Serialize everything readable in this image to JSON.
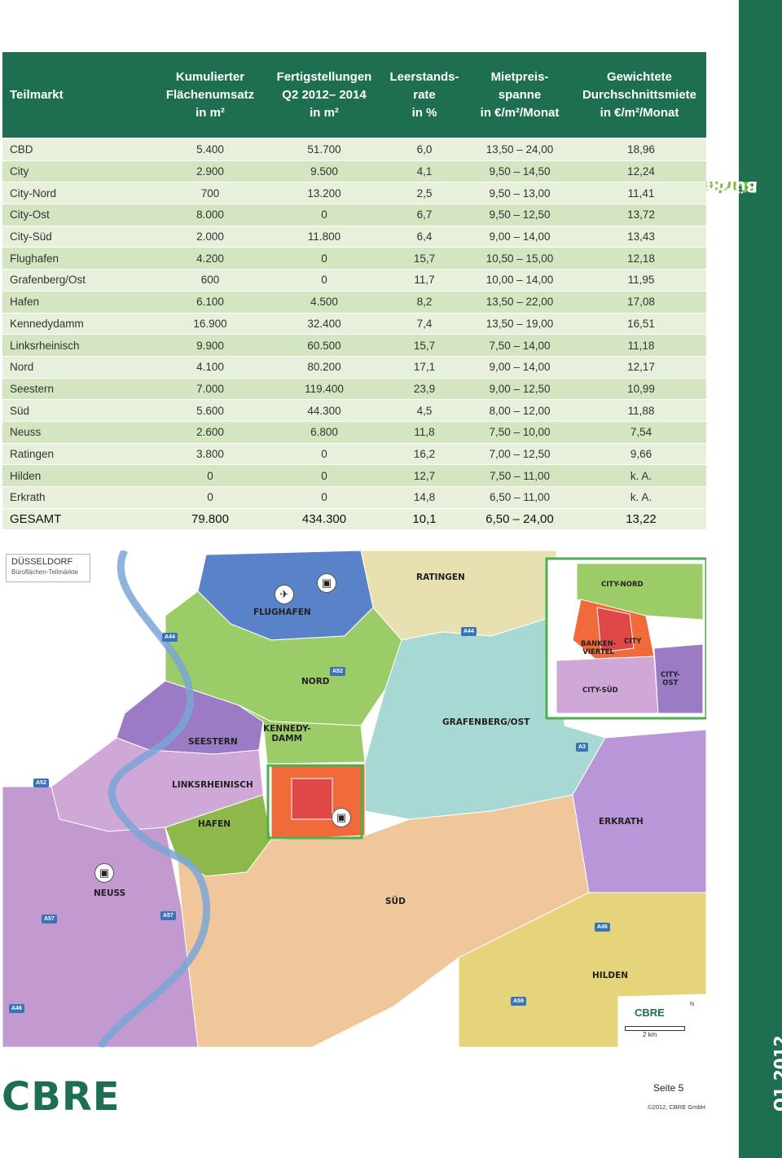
{
  "header": {
    "columns": [
      "Teilmarkt",
      "Kumulierter\nFlächenumsatz\nin m²",
      "Fertigstellungen\nQ2 2012– 2014\nin m²",
      "Leerstands-\nrate\nin %",
      "Mietpreis-\nspanne\nin €/m²/Monat",
      "Gewichtete\nDurchschnittsmiete\nin €/m²/Monat"
    ]
  },
  "rows": [
    {
      "name": "CBD",
      "umsatz": "5.400",
      "fertig": "51.700",
      "leer": "6,0",
      "spanne": "13,50 – 24,00",
      "miete": "18,96"
    },
    {
      "name": "City",
      "umsatz": "2.900",
      "fertig": "9.500",
      "leer": "4,1",
      "spanne": "9,50 – 14,50",
      "miete": "12,24"
    },
    {
      "name": "City-Nord",
      "umsatz": "700",
      "fertig": "13.200",
      "leer": "2,5",
      "spanne": "9,50 – 13,00",
      "miete": "11,41"
    },
    {
      "name": "City-Ost",
      "umsatz": "8.000",
      "fertig": "0",
      "leer": "6,7",
      "spanne": "9,50 – 12,50",
      "miete": "13,72"
    },
    {
      "name": "City-Süd",
      "umsatz": "2.000",
      "fertig": "11.800",
      "leer": "6,4",
      "spanne": "9,00 – 14,00",
      "miete": "13,43"
    },
    {
      "name": "Flughafen",
      "umsatz": "4.200",
      "fertig": "0",
      "leer": "15,7",
      "spanne": "10,50 – 15,00",
      "miete": "12,18"
    },
    {
      "name": "Grafenberg/Ost",
      "umsatz": "600",
      "fertig": "0",
      "leer": "11,7",
      "spanne": "10,00 – 14,00",
      "miete": "11,95"
    },
    {
      "name": "Hafen",
      "umsatz": "6.100",
      "fertig": "4.500",
      "leer": "8,2",
      "spanne": "13,50 – 22,00",
      "miete": "17,08"
    },
    {
      "name": "Kennedydamm",
      "umsatz": "16.900",
      "fertig": "32.400",
      "leer": "7,4",
      "spanne": "13,50 – 19,00",
      "miete": "16,51"
    },
    {
      "name": "Linksrheinisch",
      "umsatz": "9.900",
      "fertig": "60.500",
      "leer": "15,7",
      "spanne": "7,50 – 14,00",
      "miete": "11,18"
    },
    {
      "name": "Nord",
      "umsatz": "4.100",
      "fertig": "80.200",
      "leer": "17,1",
      "spanne": "9,00 – 14,00",
      "miete": "12,17"
    },
    {
      "name": "Seestern",
      "umsatz": "7.000",
      "fertig": "119.400",
      "leer": "23,9",
      "spanne": "9,00 – 12,50",
      "miete": "10,99"
    },
    {
      "name": "Süd",
      "umsatz": "5.600",
      "fertig": "44.300",
      "leer": "4,5",
      "spanne": "8,00 – 12,00",
      "miete": "11,88"
    },
    {
      "name": "Neuss",
      "umsatz": "2.600",
      "fertig": "6.800",
      "leer": "11,8",
      "spanne": "7,50 – 10,00",
      "miete": "7,54"
    },
    {
      "name": "Ratingen",
      "umsatz": "3.800",
      "fertig": "0",
      "leer": "16,2",
      "spanne": "7,00 – 12,50",
      "miete": "9,66"
    },
    {
      "name": "Hilden",
      "umsatz": "0",
      "fertig": "0",
      "leer": "12,7",
      "spanne": "7,50 – 11,00",
      "miete": "k. A."
    },
    {
      "name": "Erkrath",
      "umsatz": "0",
      "fertig": "0",
      "leer": "14,8",
      "spanne": "6,50 – 11,00",
      "miete": "k. A."
    },
    {
      "name": "GESAMT",
      "umsatz": "79.800",
      "fertig": "434.300",
      "leer": "10,1",
      "spanne": "6,50 – 24,00",
      "miete": "13,22"
    }
  ],
  "map": {
    "title": "DÜSSELDORF",
    "subtitle": "Büroflächen-Teilmärkte",
    "labels": {
      "ratingen": "RATINGEN",
      "flughafen": "FLUGHAFEN",
      "nord": "NORD",
      "kennedydamm": "KENNEDY-\nDAMM",
      "seestern": "SEESTERN",
      "linksrheinisch": "LINKSRHEINISCH",
      "hafen": "HAFEN",
      "grafenberg": "GRAFENBERG/OST",
      "erkrath": "ERKRATH",
      "neuss": "NEUSS",
      "sued": "SÜD",
      "hilden": "HILDEN",
      "city_nord": "CITY-NORD",
      "banken": "BANKEN-\nVIERTEL",
      "city": "CITY",
      "city_sued": "CITY-SÜD",
      "city_ost": "CITY-\nOST"
    },
    "highways": {
      "a44a": "A44",
      "a44b": "A44",
      "a52a": "A52",
      "a52b": "A52",
      "a3": "A3",
      "a57a": "A57",
      "a57b": "A57",
      "a46a": "A46",
      "a46b": "A46",
      "a59": "A59"
    },
    "scale": {
      "logo": "CBRE",
      "north": "N",
      "distance": "2 km"
    },
    "colors": {
      "flughafen": "#5a82c8",
      "nord": "#9ccc68",
      "ratingen": "#e8e0b0",
      "grafenberg": "#a8d8d4",
      "seestern": "#9b7bc4",
      "linksrheinisch": "#d0a8d8",
      "neuss": "#c29ad0",
      "hafen": "#8eb84a",
      "sued": "#f0c79a",
      "erkrath": "#b896d8",
      "hilden": "#e6d47a",
      "cbd": "#e04848",
      "city": "#f06a3a"
    }
  },
  "sidebar": {
    "title_brand": "MarketView",
    "title_rest": " Büromarkt Düsseldorf",
    "date": "Q1 2012"
  },
  "footer": {
    "logo": "CBRE",
    "page": "Seite 5",
    "copyright": "©2012, CBRE GmbH"
  }
}
